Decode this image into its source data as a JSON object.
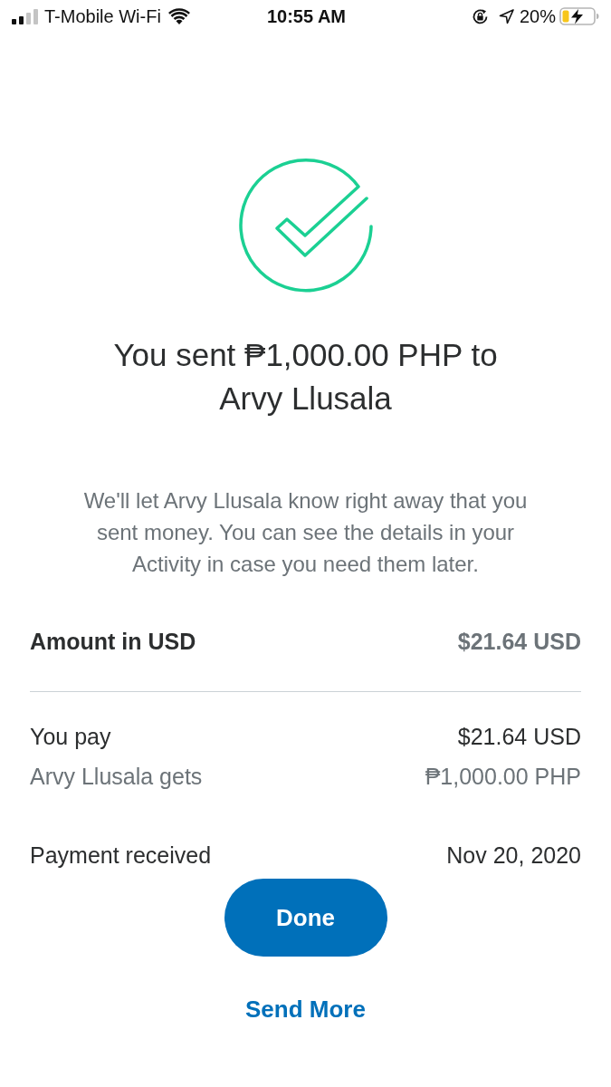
{
  "status_bar": {
    "carrier": "T-Mobile Wi-Fi",
    "time": "10:55 AM",
    "battery_percent": "20%"
  },
  "confirmation": {
    "title": "You sent ₱1,000.00 PHP to Arvy Llusala",
    "message": "We'll let Arvy Llusala know right away that you sent money. You can see the details in your Activity in case you need them later."
  },
  "summary": {
    "label": "Amount in USD",
    "value": "$21.64 USD"
  },
  "details": [
    {
      "label": "You pay",
      "value": "$21.64 USD",
      "kind": "primary"
    },
    {
      "label": "Arvy Llusala gets",
      "value": "₱1,000.00 PHP",
      "kind": "secondary"
    },
    {
      "label": "Payment received",
      "value": "Nov 20, 2020",
      "kind": "primary"
    }
  ],
  "buttons": [
    {
      "label": "Done",
      "kind": "primary"
    },
    {
      "label": "Send More",
      "kind": "link"
    }
  ]
}
